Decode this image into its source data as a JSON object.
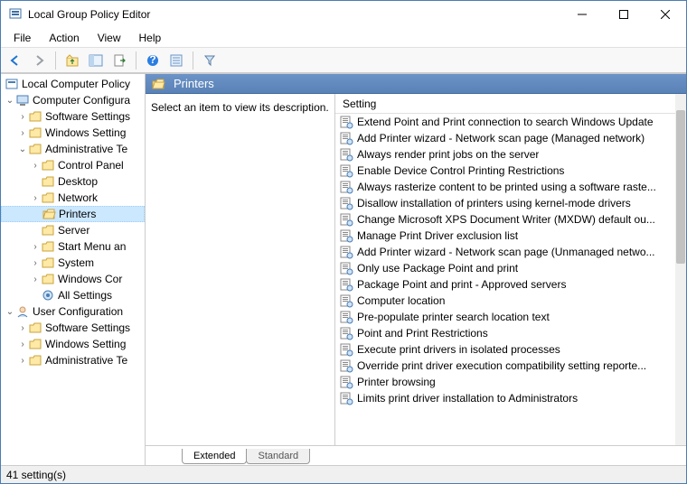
{
  "window": {
    "title": "Local Group Policy Editor"
  },
  "menu": {
    "file": "File",
    "action": "Action",
    "view": "View",
    "help": "Help"
  },
  "tree": {
    "root": "Local Computer Policy",
    "cc": "Computer Configura",
    "cc_ss": "Software Settings",
    "cc_ws": "Windows Setting",
    "cc_at": "Administrative Te",
    "cc_at_cp": "Control Panel",
    "cc_at_dk": "Desktop",
    "cc_at_nw": "Network",
    "cc_at_pr": "Printers",
    "cc_at_sv": "Server",
    "cc_at_sm": "Start Menu an",
    "cc_at_sy": "System",
    "cc_at_wc": "Windows Cor",
    "cc_at_as": "All Settings",
    "uc": "User Configuration",
    "uc_ss": "Software Settings",
    "uc_ws": "Windows Setting",
    "uc_at": "Administrative Te"
  },
  "header": {
    "title": "Printers"
  },
  "desc": {
    "text": "Select an item to view its description."
  },
  "col": {
    "setting": "Setting"
  },
  "settings": [
    "Extend Point and Print connection to search Windows Update",
    "Add Printer wizard - Network scan page (Managed network)",
    "Always render print jobs on the server",
    "Enable Device Control Printing Restrictions",
    "Always rasterize content to be printed using a software raste...",
    "Disallow installation of printers using kernel-mode drivers",
    "Change Microsoft XPS Document Writer (MXDW) default ou...",
    "Manage Print Driver exclusion list",
    "Add Printer wizard - Network scan page (Unmanaged netwo...",
    "Only use Package Point and print",
    "Package Point and print - Approved servers",
    "Computer location",
    "Pre-populate printer search location text",
    "Point and Print Restrictions",
    "Execute print drivers in isolated processes",
    "Override print driver execution compatibility setting reporte...",
    "Printer browsing",
    "Limits print driver installation to Administrators"
  ],
  "tabs": {
    "extended": "Extended",
    "standard": "Standard"
  },
  "status": {
    "text": "41 setting(s)"
  }
}
